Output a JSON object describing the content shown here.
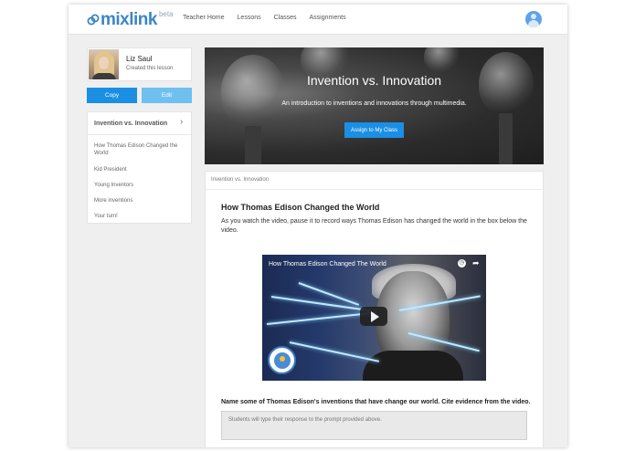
{
  "brand": {
    "logo_text": "mixlink",
    "badge": "beta",
    "accent_color": "#3b86c6"
  },
  "nav": {
    "items": [
      {
        "label": "Teacher Home"
      },
      {
        "label": "Lessons"
      },
      {
        "label": "Classes"
      },
      {
        "label": "Assignments"
      }
    ],
    "user_icon": "user-avatar-icon"
  },
  "author": {
    "name": "Liz Saul",
    "subtitle": "Created this lesson"
  },
  "actions": {
    "copy_label": "Copy",
    "edit_label": "Edit",
    "copy_color": "#1a8fe3",
    "edit_color": "#6fc0f0"
  },
  "outline": {
    "title": "Invention vs. Innovation",
    "items": [
      {
        "label": "How Thomas Edison Changed the World"
      },
      {
        "label": "Kid President"
      },
      {
        "label": "Young Inventors"
      },
      {
        "label": "More inventions"
      },
      {
        "label": "Your turn!"
      }
    ]
  },
  "hero": {
    "title": "Invention vs. Innovation",
    "subtitle": "An introduction to inventions and innovations through multimedia.",
    "assign_label": "Assign to My Class"
  },
  "content": {
    "breadcrumb": "Invention vs. Innovation",
    "section_title": "How Thomas Edison Changed the World",
    "section_desc": "As you watch the video, pause it to record ways Thomas Edison has changed the world in the box below the video.",
    "video": {
      "title": "How Thomas Edison Changed The World",
      "play_icon": "play-icon",
      "clock_icon": "clock-icon",
      "share_icon": "share-icon"
    },
    "prompt": "Name some of Thomas Edison's inventions that have change our world. Cite evidence from the video.",
    "response_placeholder": "Students will type their response to the prompt provided above."
  }
}
